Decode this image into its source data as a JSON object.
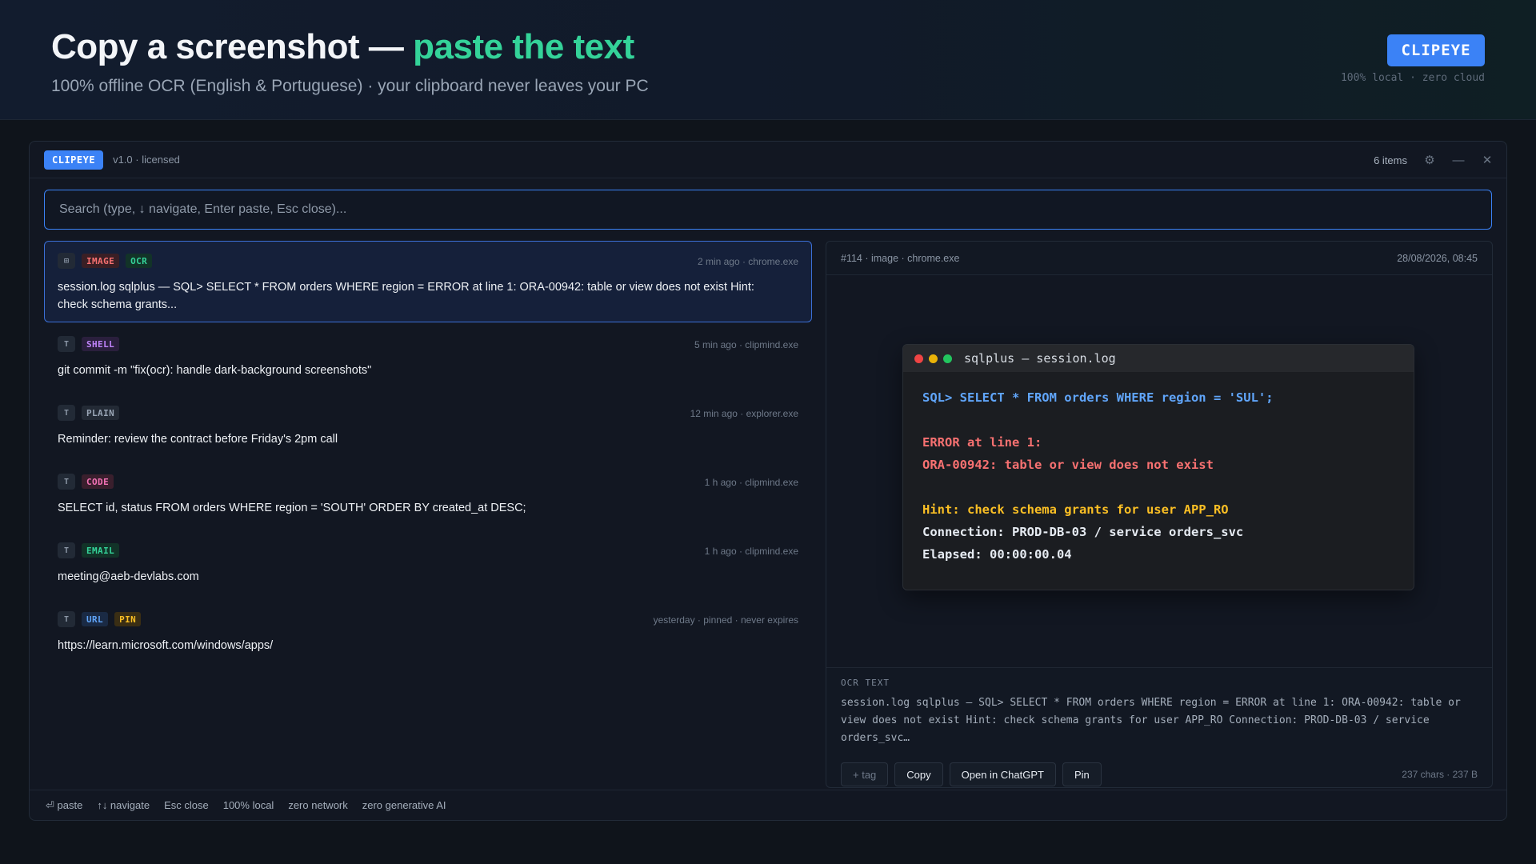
{
  "hero": {
    "title_prefix": "Copy a screenshot — ",
    "title_accent": "paste the text",
    "subtitle": "100% offline OCR (English & Portuguese) · your clipboard never leaves your PC",
    "badge": "CLIPEYE",
    "note": "100% local · zero cloud"
  },
  "window": {
    "badge": "CLIPEYE",
    "version": "v1.0 · licensed",
    "count": "6 items",
    "icons": {
      "settings": "gear-icon",
      "minimize": "minimize-icon",
      "close": "close-icon"
    }
  },
  "search": {
    "placeholder": "Search (type, ↓ navigate, Enter paste, Esc close)..."
  },
  "items": [
    {
      "icon": "⊞",
      "tags": [
        {
          "label": "IMAGE",
          "color": "#f87171",
          "bg": "#3a1f25"
        },
        {
          "label": "OCR",
          "color": "#34d399",
          "bg": "#123328"
        }
      ],
      "meta": "2 min ago · chrome.exe",
      "text": "session.log sqlplus — SQL> SELECT * FROM orders WHERE region = ERROR at line 1: ORA-00942: table or view does not exist Hint: check schema grants..."
    },
    {
      "icon": "T",
      "tags": [
        {
          "label": "SHELL",
          "color": "#c084fc",
          "bg": "#2a1f3d"
        }
      ],
      "meta": "5 min ago · clipmind.exe",
      "text": "git commit -m \"fix(ocr): handle dark-background screenshots\""
    },
    {
      "icon": "T",
      "tags": [
        {
          "label": "PLAIN",
          "color": "#9aa6b6",
          "bg": "#232a35"
        }
      ],
      "meta": "12 min ago · explorer.exe",
      "text": "Reminder: review the contract before Friday's 2pm call"
    },
    {
      "icon": "T",
      "tags": [
        {
          "label": "CODE",
          "color": "#f472b6",
          "bg": "#3a1f2d"
        }
      ],
      "meta": "1 h ago · clipmind.exe",
      "text": "SELECT id, status FROM orders WHERE region = 'SOUTH' ORDER BY created_at DESC;"
    },
    {
      "icon": "T",
      "tags": [
        {
          "label": "EMAIL",
          "color": "#34d399",
          "bg": "#123328"
        }
      ],
      "meta": "1 h ago · clipmind.exe",
      "text": "meeting@aeb-devlabs.com"
    },
    {
      "icon": "T",
      "tags": [
        {
          "label": "URL",
          "color": "#60a5fa",
          "bg": "#1a2a44"
        },
        {
          "label": "PIN",
          "color": "#fbbf24",
          "bg": "#3a2e14"
        }
      ],
      "meta": "yesterday · pinned · never expires",
      "text": "https://learn.microsoft.com/windows/apps/"
    }
  ],
  "detail": {
    "id_line": "#114 · image · chrome.exe",
    "date": "28/08/2026, 08:45",
    "terminal": {
      "title": "sqlplus — session.log",
      "lines": [
        {
          "text": "SQL> SELECT * FROM orders WHERE region = 'SUL';",
          "color": "#60a5fa"
        },
        {
          "text": "",
          "color": "#e6ebf2"
        },
        {
          "text": "ERROR at line 1:",
          "color": "#f87171"
        },
        {
          "text": "ORA-00942: table or view does not exist",
          "color": "#f87171"
        },
        {
          "text": "",
          "color": "#e6ebf2"
        },
        {
          "text": "Hint: check schema grants for user APP_RO",
          "color": "#fbbf24"
        },
        {
          "text": "Connection: PROD-DB-03 / service orders_svc",
          "color": "#e6ebf2"
        },
        {
          "text": "Elapsed: 00:00:00.04",
          "color": "#e6ebf2"
        }
      ]
    },
    "ocr_label": "OCR TEXT",
    "ocr_text": "session.log sqlplus — SQL> SELECT * FROM orders WHERE region = ERROR at line 1: ORA-00942: table or view does not exist Hint: check schema grants for user APP_RO Connection: PROD-DB-03 / service orders_svc…",
    "actions": {
      "tag": "+ tag",
      "copy": "Copy",
      "chatgpt": "Open in ChatGPT",
      "pin": "Pin"
    },
    "stats": "237 chars · 237 B"
  },
  "footer": [
    "⏎ paste",
    "↑↓ navigate",
    "Esc close",
    "100% local",
    "zero network",
    "zero generative AI"
  ]
}
